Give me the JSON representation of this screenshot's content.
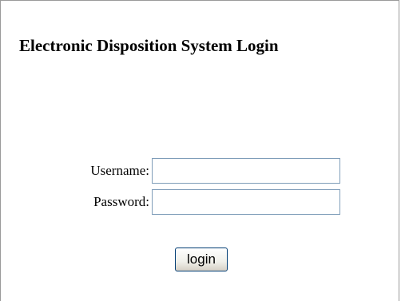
{
  "page": {
    "title": "Electronic Disposition System Login"
  },
  "form": {
    "username_label": "Username:",
    "username_value": "",
    "password_label": "Password:",
    "password_value": "",
    "login_label": "login"
  },
  "colors": {
    "field_border": "#7f9db9",
    "button_border": "#003c74",
    "frame_border": "#9a9a9a"
  }
}
